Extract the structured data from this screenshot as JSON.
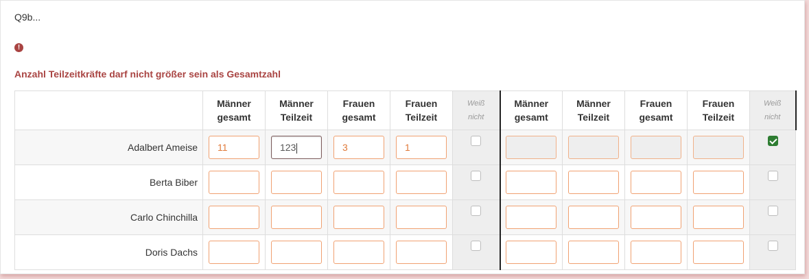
{
  "question_code": "Q9b...",
  "error_icon": "exclamation-circle-icon",
  "error_message": "Anzahl Teilzeitkräfte darf nicht größer sein als Gesamtzahl",
  "colors": {
    "error": "#a94442",
    "input_border": "#f0a070",
    "checkbox_checked": "#2e7d32"
  },
  "columns": [
    {
      "l1": "Männer",
      "l2": "gesamt"
    },
    {
      "l1": "Männer",
      "l2": "Teilzeit"
    },
    {
      "l1": "Frauen",
      "l2": "gesamt"
    },
    {
      "l1": "Frauen",
      "l2": "Teilzeit"
    },
    {
      "l1": "Weiß",
      "l2": "nicht"
    },
    {
      "l1": "Männer",
      "l2": "gesamt"
    },
    {
      "l1": "Männer",
      "l2": "Teilzeit"
    },
    {
      "l1": "Frauen",
      "l2": "gesamt"
    },
    {
      "l1": "Frauen",
      "l2": "Teilzeit"
    },
    {
      "l1": "Weiß",
      "l2": "nicht"
    }
  ],
  "rows": [
    {
      "name": "Adalbert Ameise",
      "group1": [
        "11",
        "123",
        "3",
        "1"
      ],
      "group1_dontknow": false,
      "group2": [
        "",
        "",
        "",
        ""
      ],
      "group2_dontknow": true
    },
    {
      "name": "Berta Biber",
      "group1": [
        "",
        "",
        "",
        ""
      ],
      "group1_dontknow": false,
      "group2": [
        "",
        "",
        "",
        ""
      ],
      "group2_dontknow": false
    },
    {
      "name": "Carlo Chinchilla",
      "group1": [
        "",
        "",
        "",
        ""
      ],
      "group1_dontknow": false,
      "group2": [
        "",
        "",
        "",
        ""
      ],
      "group2_dontknow": false
    },
    {
      "name": "Doris Dachs",
      "group1": [
        "",
        "",
        "",
        ""
      ],
      "group1_dontknow": false,
      "group2": [
        "",
        "",
        "",
        ""
      ],
      "group2_dontknow": false
    }
  ]
}
